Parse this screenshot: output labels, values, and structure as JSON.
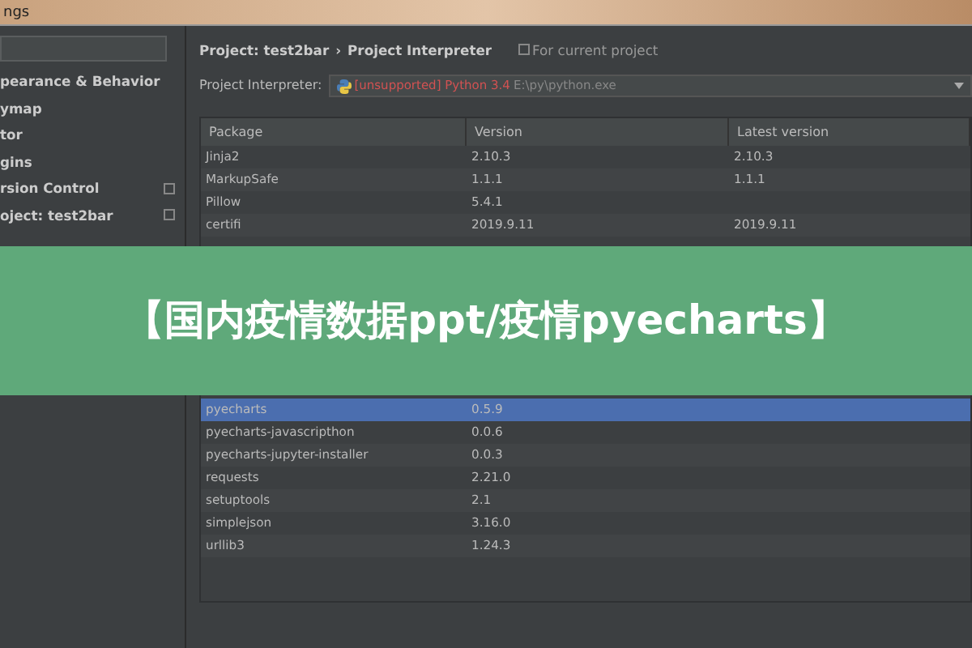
{
  "window": {
    "title": "ngs"
  },
  "sidebar": {
    "items": [
      {
        "label": "pearance & Behavior",
        "selected": false
      },
      {
        "label": "ymap",
        "selected": false
      },
      {
        "label": "tor",
        "selected": false
      },
      {
        "label": "gins",
        "selected": false
      },
      {
        "label": "rsion Control",
        "selected": false,
        "project_scoped": true
      },
      {
        "label": "oject: test2bar",
        "selected": false,
        "project_scoped": true
      }
    ]
  },
  "breadcrumb": [
    "Project: test2bar",
    "Project Interpreter"
  ],
  "breadcrumb_separator": "›",
  "scope_note": "For current project",
  "interpreter": {
    "label": "Project Interpreter:",
    "status": "[unsupported] Python 3.4",
    "path": "E:\\py\\python.exe"
  },
  "table": {
    "columns": [
      "Package",
      "Version",
      "Latest version"
    ],
    "rows_above_banner": [
      {
        "package": "Jinja2",
        "version": "2.10.3",
        "latest": "2.10.3",
        "selected": false
      },
      {
        "package": "MarkupSafe",
        "version": "1.1.1",
        "latest": "1.1.1",
        "selected": false
      },
      {
        "package": "Pillow",
        "version": "5.4.1",
        "selected": false
      },
      {
        "package": "certifi",
        "version": "2019.9.11",
        "latest": "2019.9.11",
        "selected": false
      }
    ],
    "rows_below_banner": [
      {
        "package": "pyecharts",
        "version": "0.5.9",
        "selected": true
      },
      {
        "package": "pyecharts-javascripthon",
        "version": "0.0.6",
        "selected": false
      },
      {
        "package": "pyecharts-jupyter-installer",
        "version": "0.0.3",
        "selected": false
      },
      {
        "package": "requests",
        "version": "2.21.0",
        "selected": false
      },
      {
        "package": "setuptools",
        "version": "2.1",
        "selected": false
      },
      {
        "package": "simplejson",
        "version": "3.16.0",
        "selected": false
      },
      {
        "package": "urllib3",
        "version": "1.24.3",
        "selected": false
      }
    ]
  },
  "banner": {
    "text": "【国内疫情数据ppt/疫情pyecharts】"
  }
}
